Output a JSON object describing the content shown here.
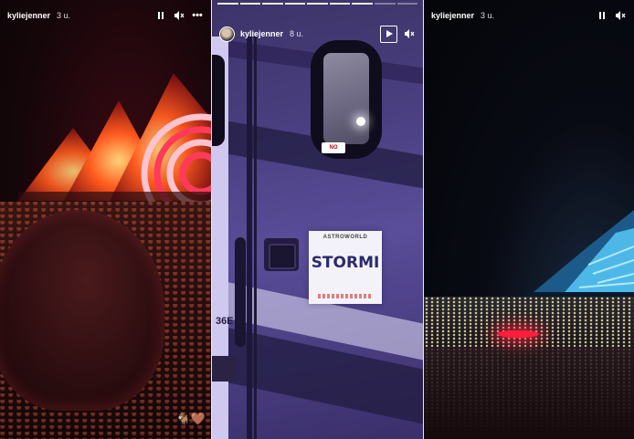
{
  "stories": [
    {
      "username": "kyliejenner",
      "time": "3 u.",
      "controls": {
        "pause_icon": "pause-icon",
        "mute_icon": "speaker-muted-icon",
        "more_icon": "more-dots-icon"
      },
      "reaction_emoji": "🐐🤎"
    },
    {
      "username": "kyliejenner",
      "time": "8 u.",
      "controls": {
        "play_icon": "play-icon",
        "mute_icon": "speaker-muted-icon"
      },
      "sign_header": "ASTROWORLD",
      "sign_name": "STORMI",
      "no_sticker": "NO",
      "vehicle_number": "36E"
    },
    {
      "username": "kyliejenner",
      "time": "3 u.",
      "controls": {
        "pause_icon": "pause-icon",
        "mute_icon": "speaker-muted-icon"
      }
    }
  ],
  "colors": {
    "divider": "#e8e8e8",
    "stage_fire": "#ff5a1e",
    "stage_blue": "#5ad0ff",
    "sign_text": "#2a2a6e"
  }
}
